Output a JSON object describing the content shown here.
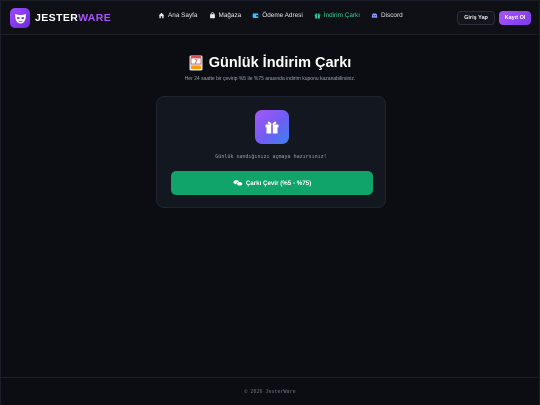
{
  "brand": {
    "name_part1": "JESTER",
    "name_part2": "WARE",
    "logo_icon": "mask-icon",
    "accent_color": "#a855f7"
  },
  "nav": {
    "items": [
      {
        "label": "Ana Sayfa",
        "icon": "home-icon",
        "active": false
      },
      {
        "label": "Mağaza",
        "icon": "bag-icon",
        "active": false
      },
      {
        "label": "Ödeme Adresi",
        "icon": "wallet-icon",
        "active": false
      },
      {
        "label": "İndirim Çarkı",
        "icon": "gift-icon",
        "active": true
      },
      {
        "label": "Discord",
        "icon": "discord-icon",
        "active": false
      }
    ],
    "active_color": "#34d399"
  },
  "auth": {
    "login_label": "Giriş Yap",
    "register_label": "Kayıt Ol"
  },
  "header": {
    "title": "Günlük İndirim Çarkı",
    "title_icon": "slot-machine-icon",
    "subtitle": "Her 24 saatte bir çevirip %5 ile %75 arasında indirim kuponu kazanabilirsiniz."
  },
  "card": {
    "icon": "gift-icon",
    "message": "Günlük sandığınızı açmaya hazırsınız!",
    "button_label": "Çarkı Çevir (%5 - %75)",
    "button_icon": "coins-icon",
    "button_color": "#10a36a"
  },
  "footer": {
    "text": "© 2026 JesterWare"
  }
}
